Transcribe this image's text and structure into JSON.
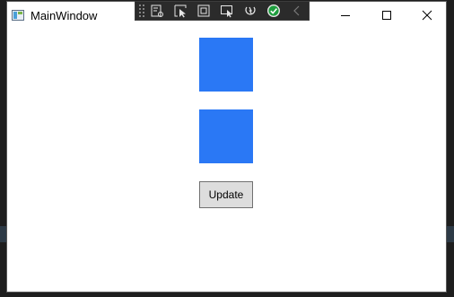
{
  "window": {
    "title": "MainWindow"
  },
  "title_controls": {
    "minimize_icon": "minimize-icon",
    "maximize_icon": "maximize-icon",
    "close_icon": "close-icon"
  },
  "debug_toolbar": {
    "tools": [
      "live-visual-tree-icon",
      "select-element-icon",
      "display-layout-adorners-icon",
      "track-focused-element-icon",
      "hot-reload-icon",
      "binding-success-icon",
      "collapse-icon"
    ],
    "hot_reload_color": "#1e9e3e"
  },
  "content": {
    "square_color": "#2a78f5",
    "button_label": "Update"
  }
}
